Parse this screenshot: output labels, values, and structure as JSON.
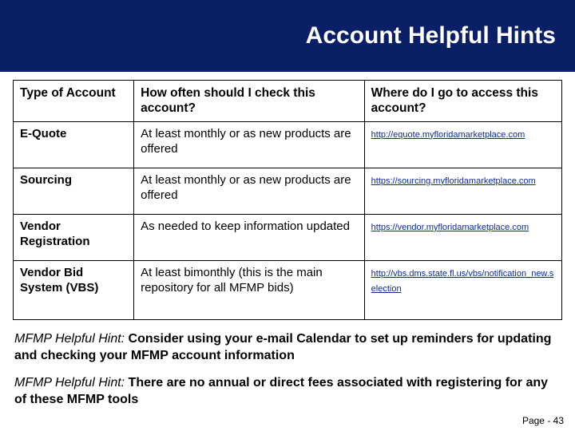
{
  "header": {
    "title": "Account Helpful Hints"
  },
  "table": {
    "headers": {
      "type": "Type of Account",
      "frequency": "How often should I check this account?",
      "access": "Where do I go to access this account?"
    },
    "rows": [
      {
        "type": "E-Quote",
        "frequency": "At least monthly or as new products are offered",
        "link_text": "http://equote.myfloridamarketplace.com",
        "link_href": "http://equote.myfloridamarketplace.com"
      },
      {
        "type": "Sourcing",
        "frequency": "At least monthly or as new products are offered",
        "link_text": "https://sourcing.myfloridamarketplace.com",
        "link_href": "https://sourcing.myfloridamarketplace.com"
      },
      {
        "type": "Vendor Registration",
        "frequency": "As needed to keep information updated",
        "link_text": "https://vendor.myfloridamarketplace.com",
        "link_href": "https://vendor.myfloridamarketplace.com"
      },
      {
        "type": "Vendor Bid System (VBS)",
        "frequency": "At least bimonthly (this is the main repository for all MFMP bids)",
        "link_text": "http://vbs.dms.state.fl.us/vbs/notification_new.selection",
        "link_href": "http://vbs.dms.state.fl.us/vbs/notification_new.selection"
      }
    ]
  },
  "hints": [
    {
      "lead": "MFMP Helpful Hint: ",
      "body": "Consider using your e-mail Calendar to set up reminders for updating and checking your MFMP account information"
    },
    {
      "lead": "MFMP Helpful Hint: ",
      "body": "There are no annual or direct fees associated with registering for any of these MFMP tools"
    }
  ],
  "page_label": "Page -  43"
}
